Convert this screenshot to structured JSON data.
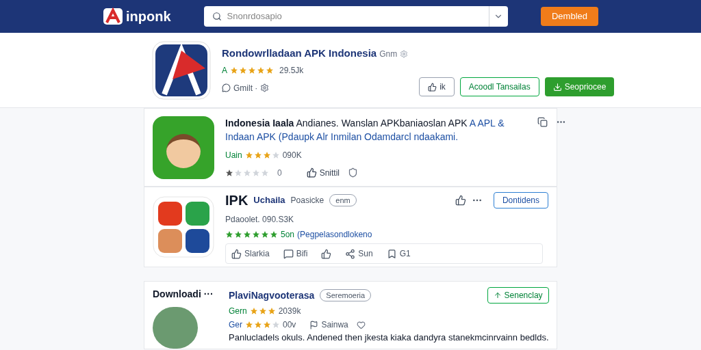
{
  "header": {
    "logo_text": "inponk",
    "search": {
      "placeholder": "Snonrdosapio"
    },
    "button": "Dembled"
  },
  "hero": {
    "title": "Rondowrlladaan APK Indonesia",
    "subtitle": "Gnm",
    "stars": 5,
    "rating_prefix": "A",
    "rating_count": "29.5Jk",
    "meta": "Gmilt ·",
    "buttons": [
      {
        "kind": "icon",
        "label": "ik"
      },
      {
        "kind": "outline",
        "label": "Acoodl Tansailas"
      },
      {
        "kind": "primary",
        "label": "Seopriocee"
      }
    ]
  },
  "cards": [
    {
      "kind": "description",
      "description": "**Indonesia Iaala** Andianes. Wanslan APKbaniaoslan APK",
      "description_link": "A APL & Indaan APK (Pdaupk Alr Inmilan Odamdarcl ndaakami.",
      "tag": "Uain",
      "stars": 3,
      "count": "090K",
      "user_rating": {
        "stars": 1,
        "count": "0"
      },
      "action": "Snittil"
    },
    {
      "kind": "actions",
      "title": "IPK",
      "publisher": "Uchaila",
      "category": "Poasicke",
      "badge": "enm",
      "stats": "Pdaoolet. 090.S3K",
      "stars": 6,
      "stars_text": "5on",
      "stars_link": "(Pegpelasondlokeno",
      "button": "Dontidens",
      "actions": [
        {
          "kind": "like",
          "label": "Slarkia"
        },
        {
          "kind": "comment",
          "label": "Bifi"
        },
        {
          "kind": "thumb"
        },
        {
          "kind": "share",
          "label": "Sun"
        },
        {
          "kind": "tag",
          "label": "G1"
        }
      ]
    },
    {
      "kind": "review",
      "heading": "Downloadi ···",
      "title": "PlaviNagvooterasa",
      "badge": "Seremoeria",
      "tag": "Gern",
      "stars": 3,
      "count": "2039k",
      "second_rating": {
        "tag": "Ger",
        "stars": 3,
        "count": "00v"
      },
      "action": "Sainwa",
      "text": "Panlucladels okuls. Andened then jkesta kiaka dandyra stanekmcinrvainn bedlds.",
      "button": "Senenclay"
    }
  ]
}
